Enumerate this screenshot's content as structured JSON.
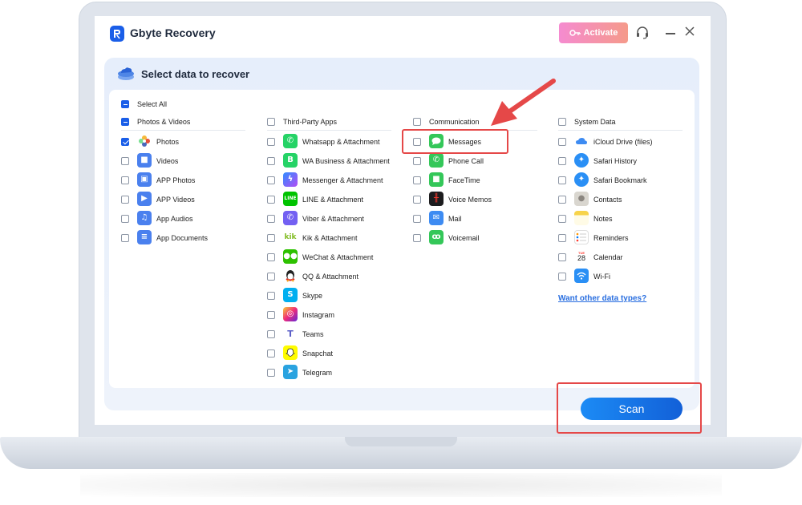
{
  "app": {
    "title": "Gbyte Recovery",
    "activate_label": "Activate"
  },
  "panel": {
    "title": "Select data to recover",
    "select_all_label": "Select All"
  },
  "columns": {
    "photos": {
      "header": "Photos & Videos",
      "items": [
        {
          "label": "Photos",
          "checked": true,
          "icon": "photos-icon"
        },
        {
          "label": "Videos",
          "checked": false,
          "icon": "videos-icon"
        },
        {
          "label": "APP Photos",
          "checked": false,
          "icon": "app-photos-icon"
        },
        {
          "label": "APP Videos",
          "checked": false,
          "icon": "app-videos-icon"
        },
        {
          "label": "App Audios",
          "checked": false,
          "icon": "app-audios-icon"
        },
        {
          "label": "App Documents",
          "checked": false,
          "icon": "app-documents-icon"
        }
      ]
    },
    "third_party": {
      "header": "Third-Party Apps",
      "items": [
        {
          "label": "Whatsapp & Attachment",
          "icon": "whatsapp-icon"
        },
        {
          "label": "WA Business & Attachment",
          "icon": "wa-business-icon"
        },
        {
          "label": "Messenger & Attachment",
          "icon": "messenger-icon"
        },
        {
          "label": "LINE & Attachment",
          "icon": "line-icon"
        },
        {
          "label": "Viber & Attachment",
          "icon": "viber-icon"
        },
        {
          "label": "Kik & Attachment",
          "icon": "kik-icon"
        },
        {
          "label": "WeChat & Attachment",
          "icon": "wechat-icon"
        },
        {
          "label": "QQ & Attachment",
          "icon": "qq-icon"
        },
        {
          "label": "Skype",
          "icon": "skype-icon"
        },
        {
          "label": "Instagram",
          "icon": "instagram-icon"
        },
        {
          "label": "Teams",
          "icon": "teams-icon"
        },
        {
          "label": "Snapchat",
          "icon": "snapchat-icon"
        },
        {
          "label": "Telegram",
          "icon": "telegram-icon"
        }
      ]
    },
    "communication": {
      "header": "Communication",
      "items": [
        {
          "label": "Messages",
          "icon": "messages-icon"
        },
        {
          "label": "Phone Call",
          "icon": "phone-icon"
        },
        {
          "label": "FaceTime",
          "icon": "facetime-icon"
        },
        {
          "label": "Voice Memos",
          "icon": "voice-memos-icon"
        },
        {
          "label": "Mail",
          "icon": "mail-icon"
        },
        {
          "label": "Voicemail",
          "icon": "voicemail-icon"
        }
      ]
    },
    "system": {
      "header": "System Data",
      "items": [
        {
          "label": "iCloud Drive (files)",
          "icon": "icloud-icon"
        },
        {
          "label": "Safari History",
          "icon": "safari-history-icon"
        },
        {
          "label": "Safari Bookmark",
          "icon": "safari-bookmark-icon"
        },
        {
          "label": "Contacts",
          "icon": "contacts-icon"
        },
        {
          "label": "Notes",
          "icon": "notes-icon"
        },
        {
          "label": "Reminders",
          "icon": "reminders-icon"
        },
        {
          "label": "Calendar",
          "icon": "calendar-icon",
          "icon_text": [
            "TUE",
            "28"
          ]
        },
        {
          "label": "Wi-Fi",
          "icon": "wifi-icon"
        }
      ],
      "other_link": "Want other data types?"
    }
  },
  "scan_label": "Scan",
  "colors": {
    "accent": "#1a5ee8",
    "highlight": "#e54848"
  }
}
